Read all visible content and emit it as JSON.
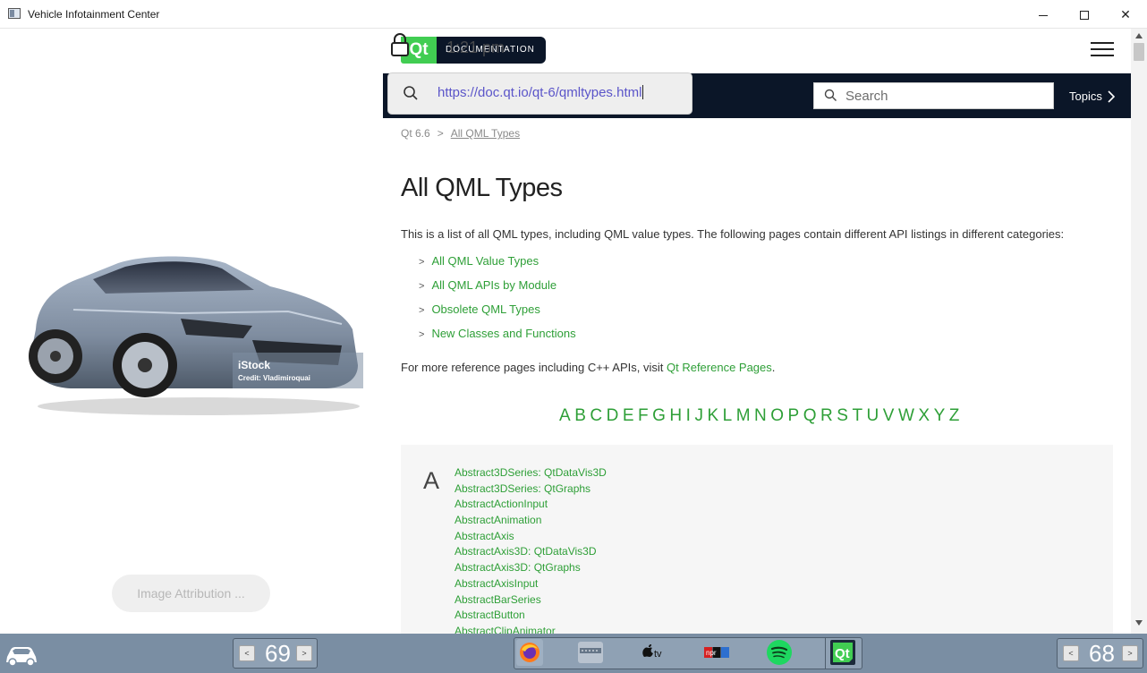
{
  "window": {
    "title": "Vehicle Infotainment Center",
    "minimize_glyph": "—",
    "close_glyph": "✕"
  },
  "left_panel": {
    "watermark_brand": "iStock",
    "watermark_credit": "Credit: Vladimiroquai",
    "attribution_button": "Image Attribution ..."
  },
  "header": {
    "qt_logo": "Qt",
    "doc_label": "DOCUMENTATION",
    "clock": "1:21 pm",
    "url": "https://doc.qt.io/qt-6/qmltypes.html",
    "search_placeholder": "Search",
    "topics_label": "Topics"
  },
  "breadcrumb": {
    "items": [
      "Qt 6.6",
      "All QML Types"
    ]
  },
  "content": {
    "title": "All QML Types",
    "intro": "This is a list of all QML types, including QML value types. The following pages contain different API listings in different categories:",
    "links": [
      "All QML Value Types",
      "All QML APIs by Module",
      "Obsolete QML Types",
      "New Classes and Functions"
    ],
    "more_ref_prefix": "For more reference pages including C++ APIs, visit ",
    "more_ref_link": "Qt Reference Pages",
    "more_ref_suffix": ".",
    "alphabet": [
      "A",
      "B",
      "C",
      "D",
      "E",
      "F",
      "G",
      "H",
      "I",
      "J",
      "K",
      "L",
      "M",
      "N",
      "O",
      "P",
      "Q",
      "R",
      "S",
      "T",
      "U",
      "V",
      "W",
      "X",
      "Y",
      "Z"
    ],
    "section_letter": "A",
    "types": [
      "Abstract3DSeries: QtDataVis3D",
      "Abstract3DSeries: QtGraphs",
      "AbstractActionInput",
      "AbstractAnimation",
      "AbstractAxis",
      "AbstractAxis3D: QtDataVis3D",
      "AbstractAxis3D: QtGraphs",
      "AbstractAxisInput",
      "AbstractBarSeries",
      "AbstractButton",
      "AbstractClipAnimator"
    ]
  },
  "dock": {
    "left_temperature": "69",
    "right_temperature": "68",
    "decrease_glyph": "<",
    "increase_glyph": ">",
    "apps": [
      "firefox",
      "tuner",
      "apple-tv",
      "npr",
      "spotify",
      "qt"
    ],
    "apple_tv_label": "tv",
    "npr_label": "npr",
    "qt_label": "Qt"
  },
  "colors": {
    "qt_green": "#41cd52",
    "link_green": "#2e9f37",
    "navy": "#0b1628",
    "dock": "#7a8ea3",
    "url_text": "#5b55c9"
  }
}
